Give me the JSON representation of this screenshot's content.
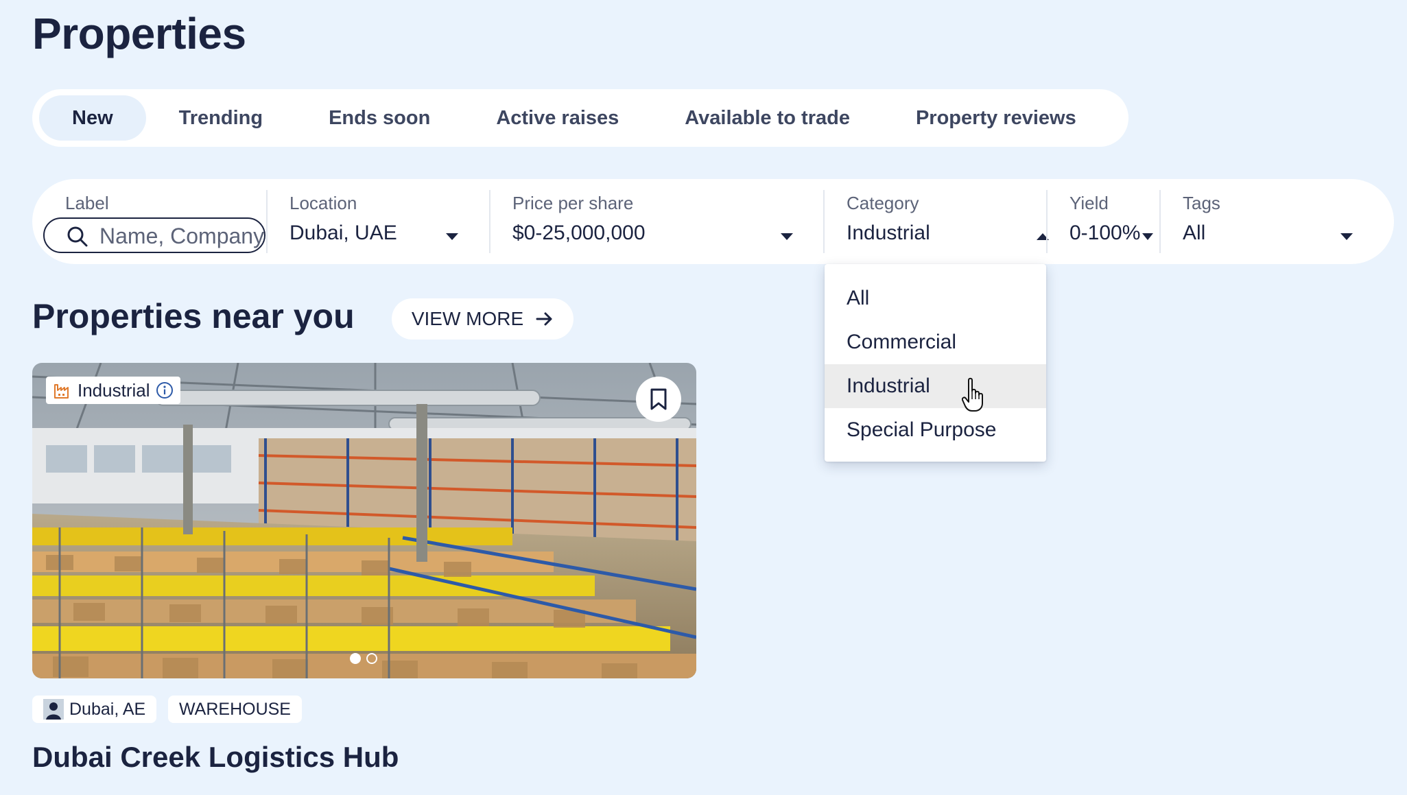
{
  "page": {
    "title": "Properties"
  },
  "tabs": [
    {
      "label": "New",
      "active": true
    },
    {
      "label": "Trending"
    },
    {
      "label": "Ends soon"
    },
    {
      "label": "Active raises"
    },
    {
      "label": "Available to trade"
    },
    {
      "label": "Property reviews"
    }
  ],
  "filters": {
    "label": {
      "title": "Label",
      "placeholder": "Name, Company"
    },
    "location": {
      "title": "Location",
      "value": "Dubai, UAE"
    },
    "price": {
      "title": "Price per share",
      "value": "$0-25,000,000"
    },
    "category": {
      "title": "Category",
      "value": "Industrial",
      "expanded": true
    },
    "yield": {
      "title": "Yield",
      "value": "0-100%"
    },
    "tags": {
      "title": "Tags",
      "value": "All"
    }
  },
  "category_dropdown": {
    "options": [
      "All",
      "Commercial",
      "Industrial",
      "Special Purpose"
    ],
    "selected": "Industrial"
  },
  "section": {
    "title": "Properties near you",
    "view_more_label": "VIEW MORE"
  },
  "card": {
    "category_badge": "Industrial",
    "location": "Dubai, AE",
    "type": "WAREHOUSE",
    "title": "Dubai Creek Logistics Hub",
    "image_count": 2,
    "image_index": 1
  },
  "colors": {
    "background": "#eaf3fd",
    "text": "#1b2340",
    "active_tab": "#e6f0fb",
    "badge_icon": "#e07a2c"
  }
}
